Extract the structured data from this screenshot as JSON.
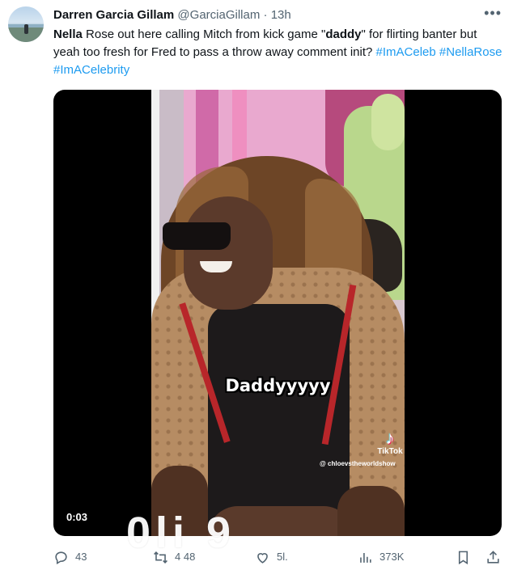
{
  "tweet": {
    "author_name": "Darren Garcia Gillam",
    "handle": "@GarciaGillam",
    "separator": "·",
    "time": "13h",
    "more_icon": "more-dots-icon",
    "text_bold": "Nella",
    "text_line1": " Rose out here calling Mitch from kick game \"",
    "text_quoted_bold": "daddy",
    "text_line1_end": "\" for flirting banter but yeah too fresh for Fred to pass a throw away comment init? ",
    "hashtags": [
      "#ImACeleb",
      "#NellaRose",
      "#ImACelebrity"
    ]
  },
  "media": {
    "caption": "Daddyyyyy",
    "tiktok_label": "TikTok",
    "tiktok_user": "@ chloevstheworldshow",
    "duration": "0:03",
    "watermark": "0li   9"
  },
  "actions": {
    "reply": {
      "icon": "reply-icon",
      "count": "43"
    },
    "retweet": {
      "icon": "retweet-icon",
      "count": "4 48"
    },
    "like": {
      "icon": "like-icon",
      "count": "5l."
    },
    "views": {
      "icon": "views-icon",
      "count": "373K"
    },
    "bookmark": {
      "icon": "bookmark-icon"
    },
    "share": {
      "icon": "share-icon"
    }
  },
  "colors": {
    "text": "#0f1419",
    "muted": "#536471",
    "link": "#1d9bf0"
  }
}
